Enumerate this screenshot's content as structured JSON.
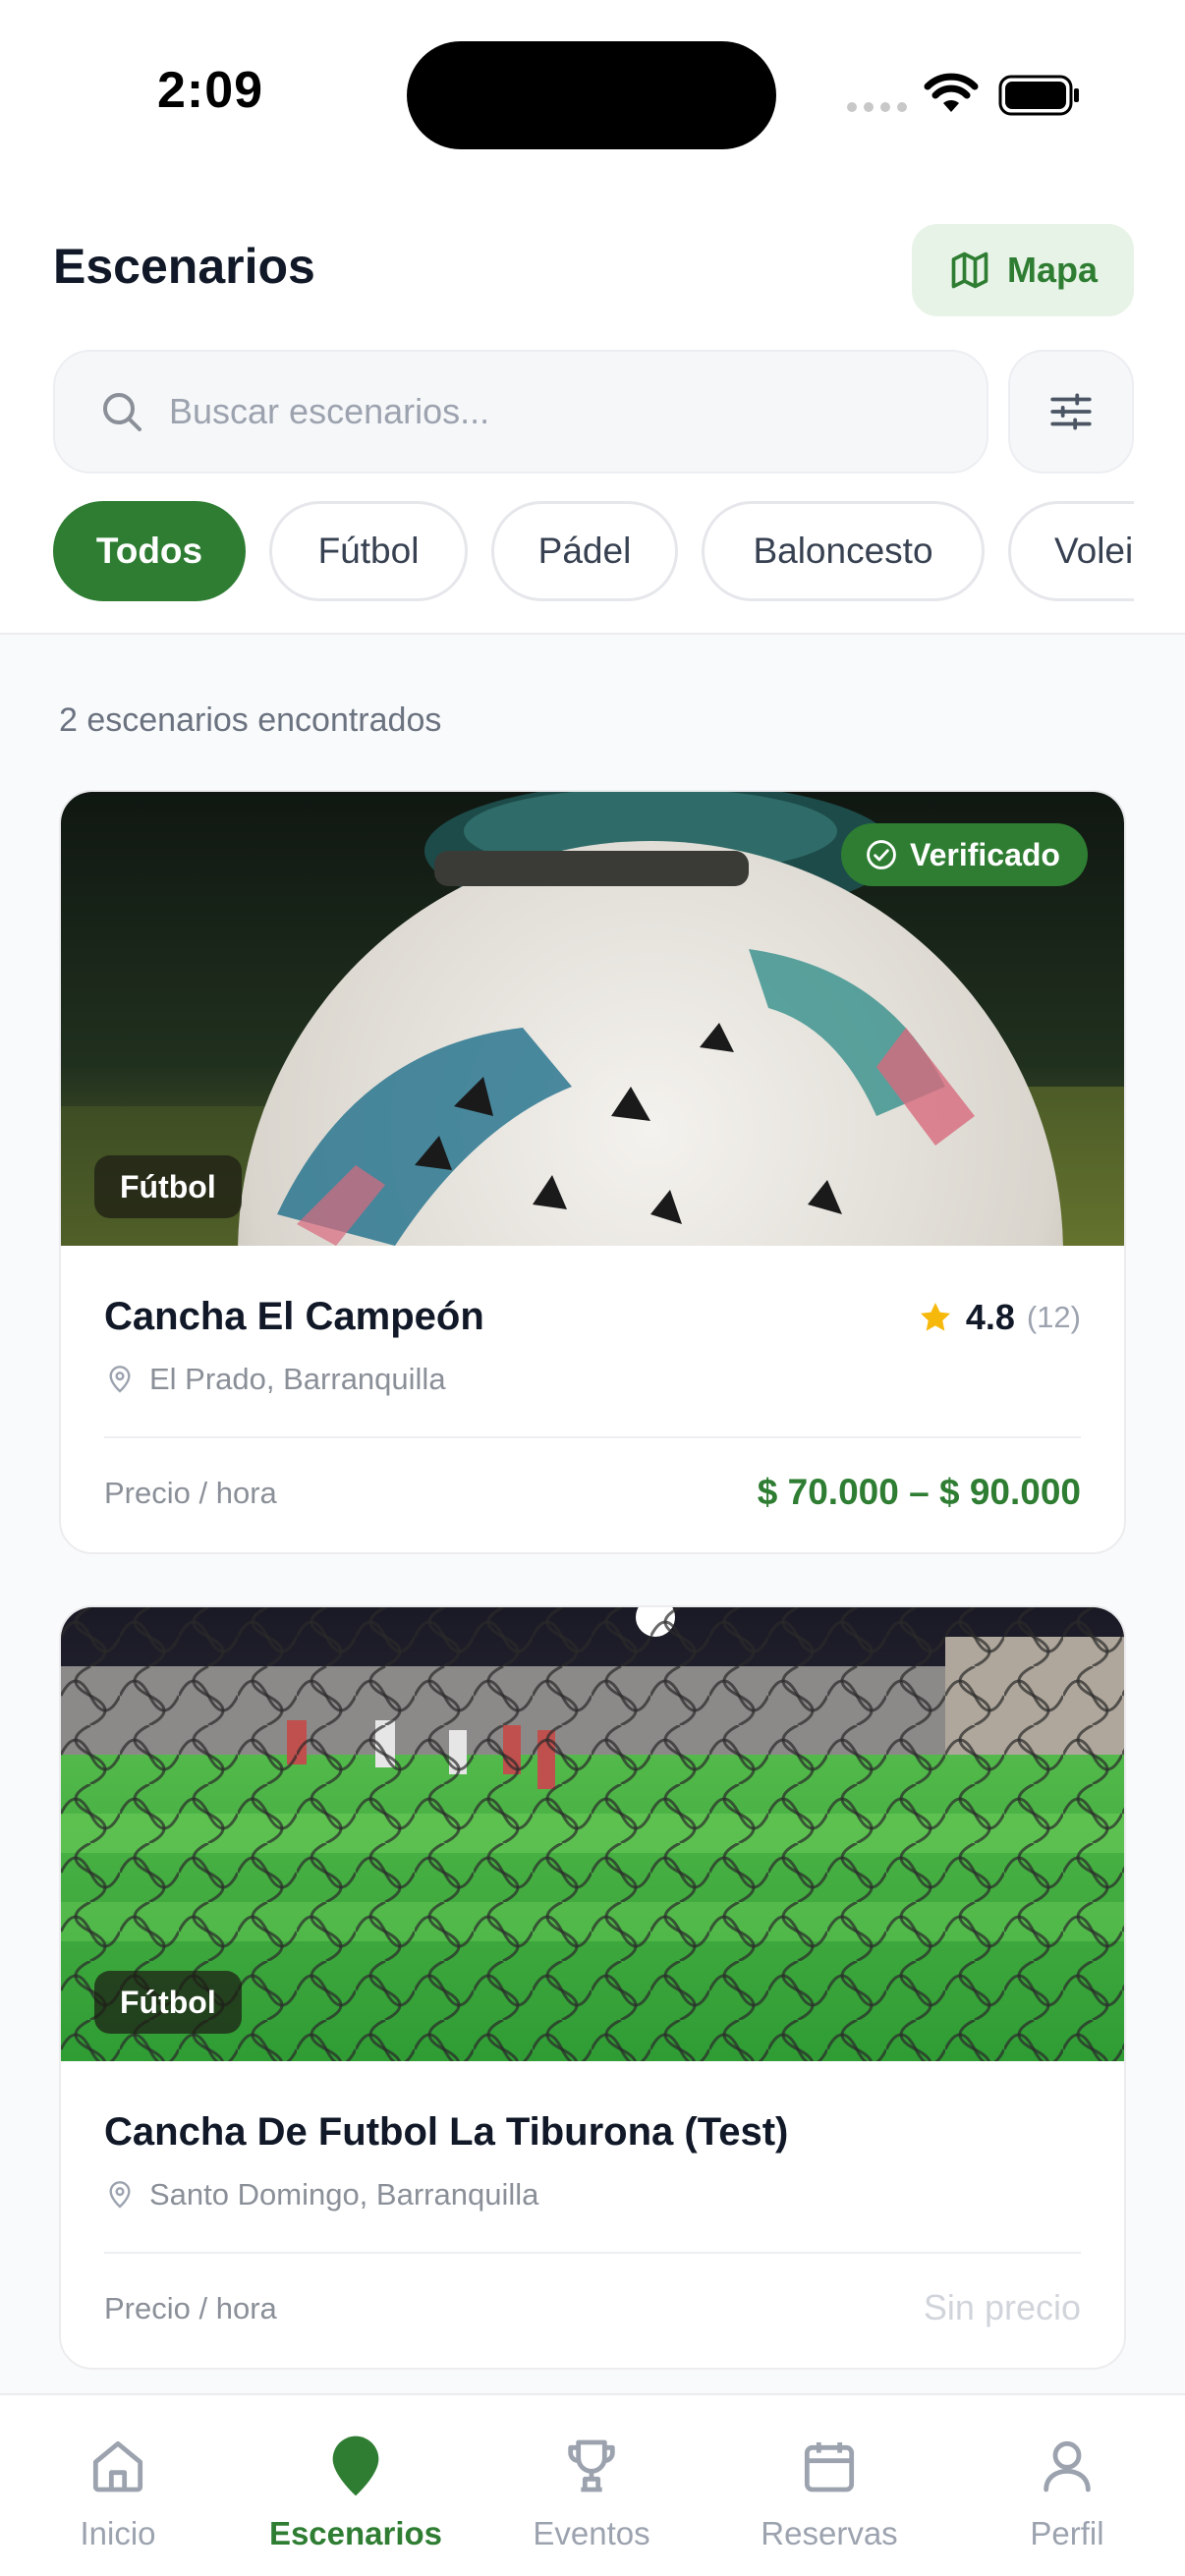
{
  "status_bar": {
    "time": "2:09"
  },
  "header": {
    "title": "Escenarios",
    "map_button_label": "Mapa",
    "search_placeholder": "Buscar escenarios..."
  },
  "filters": [
    {
      "label": "Todos",
      "active": true
    },
    {
      "label": "Fútbol",
      "active": false
    },
    {
      "label": "Pádel",
      "active": false
    },
    {
      "label": "Baloncesto",
      "active": false
    },
    {
      "label": "Voleibol",
      "active": false
    }
  ],
  "results": {
    "count_text": "2 escenarios encontrados",
    "cards": [
      {
        "sport": "Fútbol",
        "verified_label": "Verificado",
        "title": "Cancha El Campeón",
        "rating": "4.8",
        "rating_count": "(12)",
        "location": "El Prado, Barranquilla",
        "price_label": "Precio / hora",
        "price": "$ 70.000 – $ 90.000"
      },
      {
        "sport": "Fútbol",
        "title": "Cancha De Futbol La Tiburona (Test)",
        "location": "Santo Domingo, Barranquilla",
        "price_label": "Precio / hora",
        "price": "Sin precio"
      }
    ]
  },
  "bottom_nav": [
    {
      "label": "Inicio",
      "icon": "home-icon",
      "active": false
    },
    {
      "label": "Escenarios",
      "icon": "location-pin-icon",
      "active": true
    },
    {
      "label": "Eventos",
      "icon": "trophy-icon",
      "active": false
    },
    {
      "label": "Reservas",
      "icon": "calendar-icon",
      "active": false
    },
    {
      "label": "Perfil",
      "icon": "user-icon",
      "active": false
    }
  ],
  "colors": {
    "primary": "#2e7d32",
    "primary_light": "#e7f3e6",
    "text": "#111827",
    "muted": "#9ca3af",
    "star": "#f6b90b"
  }
}
